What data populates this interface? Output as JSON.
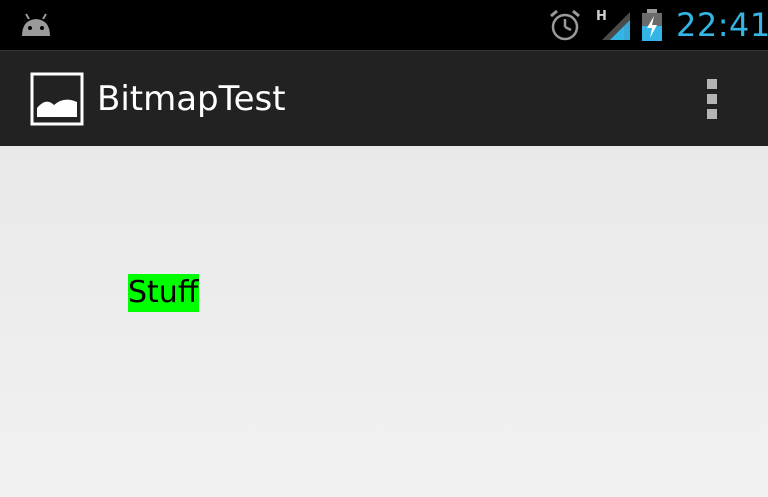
{
  "status_bar": {
    "time": "22:41",
    "network_type": "H",
    "icons": [
      "android-icon",
      "alarm-icon",
      "signal-icon",
      "battery-icon"
    ],
    "time_color": "#33b5e5"
  },
  "action_bar": {
    "title": "BitmapTest",
    "icon": "image-icon",
    "menu_icon": "overflow-menu-icon"
  },
  "content": {
    "text_view": "Stuff",
    "text_view_bg": "#00ff00"
  }
}
